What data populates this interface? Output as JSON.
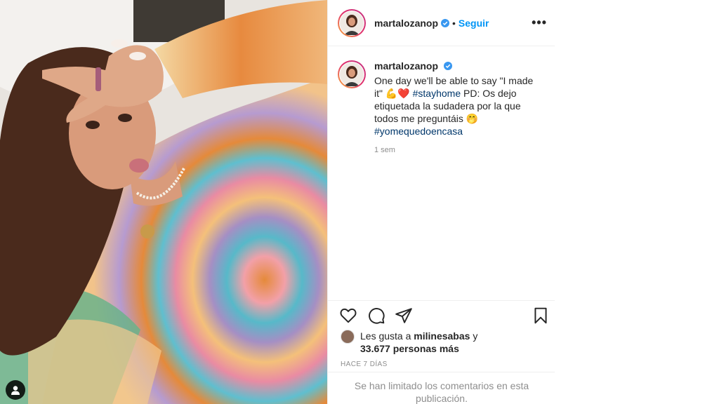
{
  "post": {
    "username": "martalozanop",
    "follow_label": "Seguir",
    "separator": "•",
    "more_label": "•••"
  },
  "caption": {
    "username": "martalozanop",
    "text_part1": "One day we'll be able to say \"I made it\" ",
    "emojis": "💪❤️",
    "hashtag1": "#stayhome",
    "text_part2": " PD: Os dejo etiquetada la sudadera por la que todos me preguntáis ",
    "emoji2": "🤭",
    "hashtag2": "#yomequedoencasa",
    "time": "1 sem"
  },
  "likes": {
    "prefix": "Les gusta a ",
    "user": "milinesabas",
    "middle": " y",
    "count": "33.677 personas más"
  },
  "days_ago": "HACE 7 DÍAS",
  "comments_limited": "Se han limitado los comentarios en esta publicación.",
  "icons": {
    "like": "heart-icon",
    "comment": "comment-icon",
    "share": "share-icon",
    "save": "bookmark-icon",
    "verified": "verified-badge-icon",
    "user_tag": "user-tag-icon"
  },
  "colors": {
    "accent": "#0095f6",
    "hashtag": "#00376b",
    "muted": "#8e8e8e",
    "verified": "#3897f0"
  }
}
